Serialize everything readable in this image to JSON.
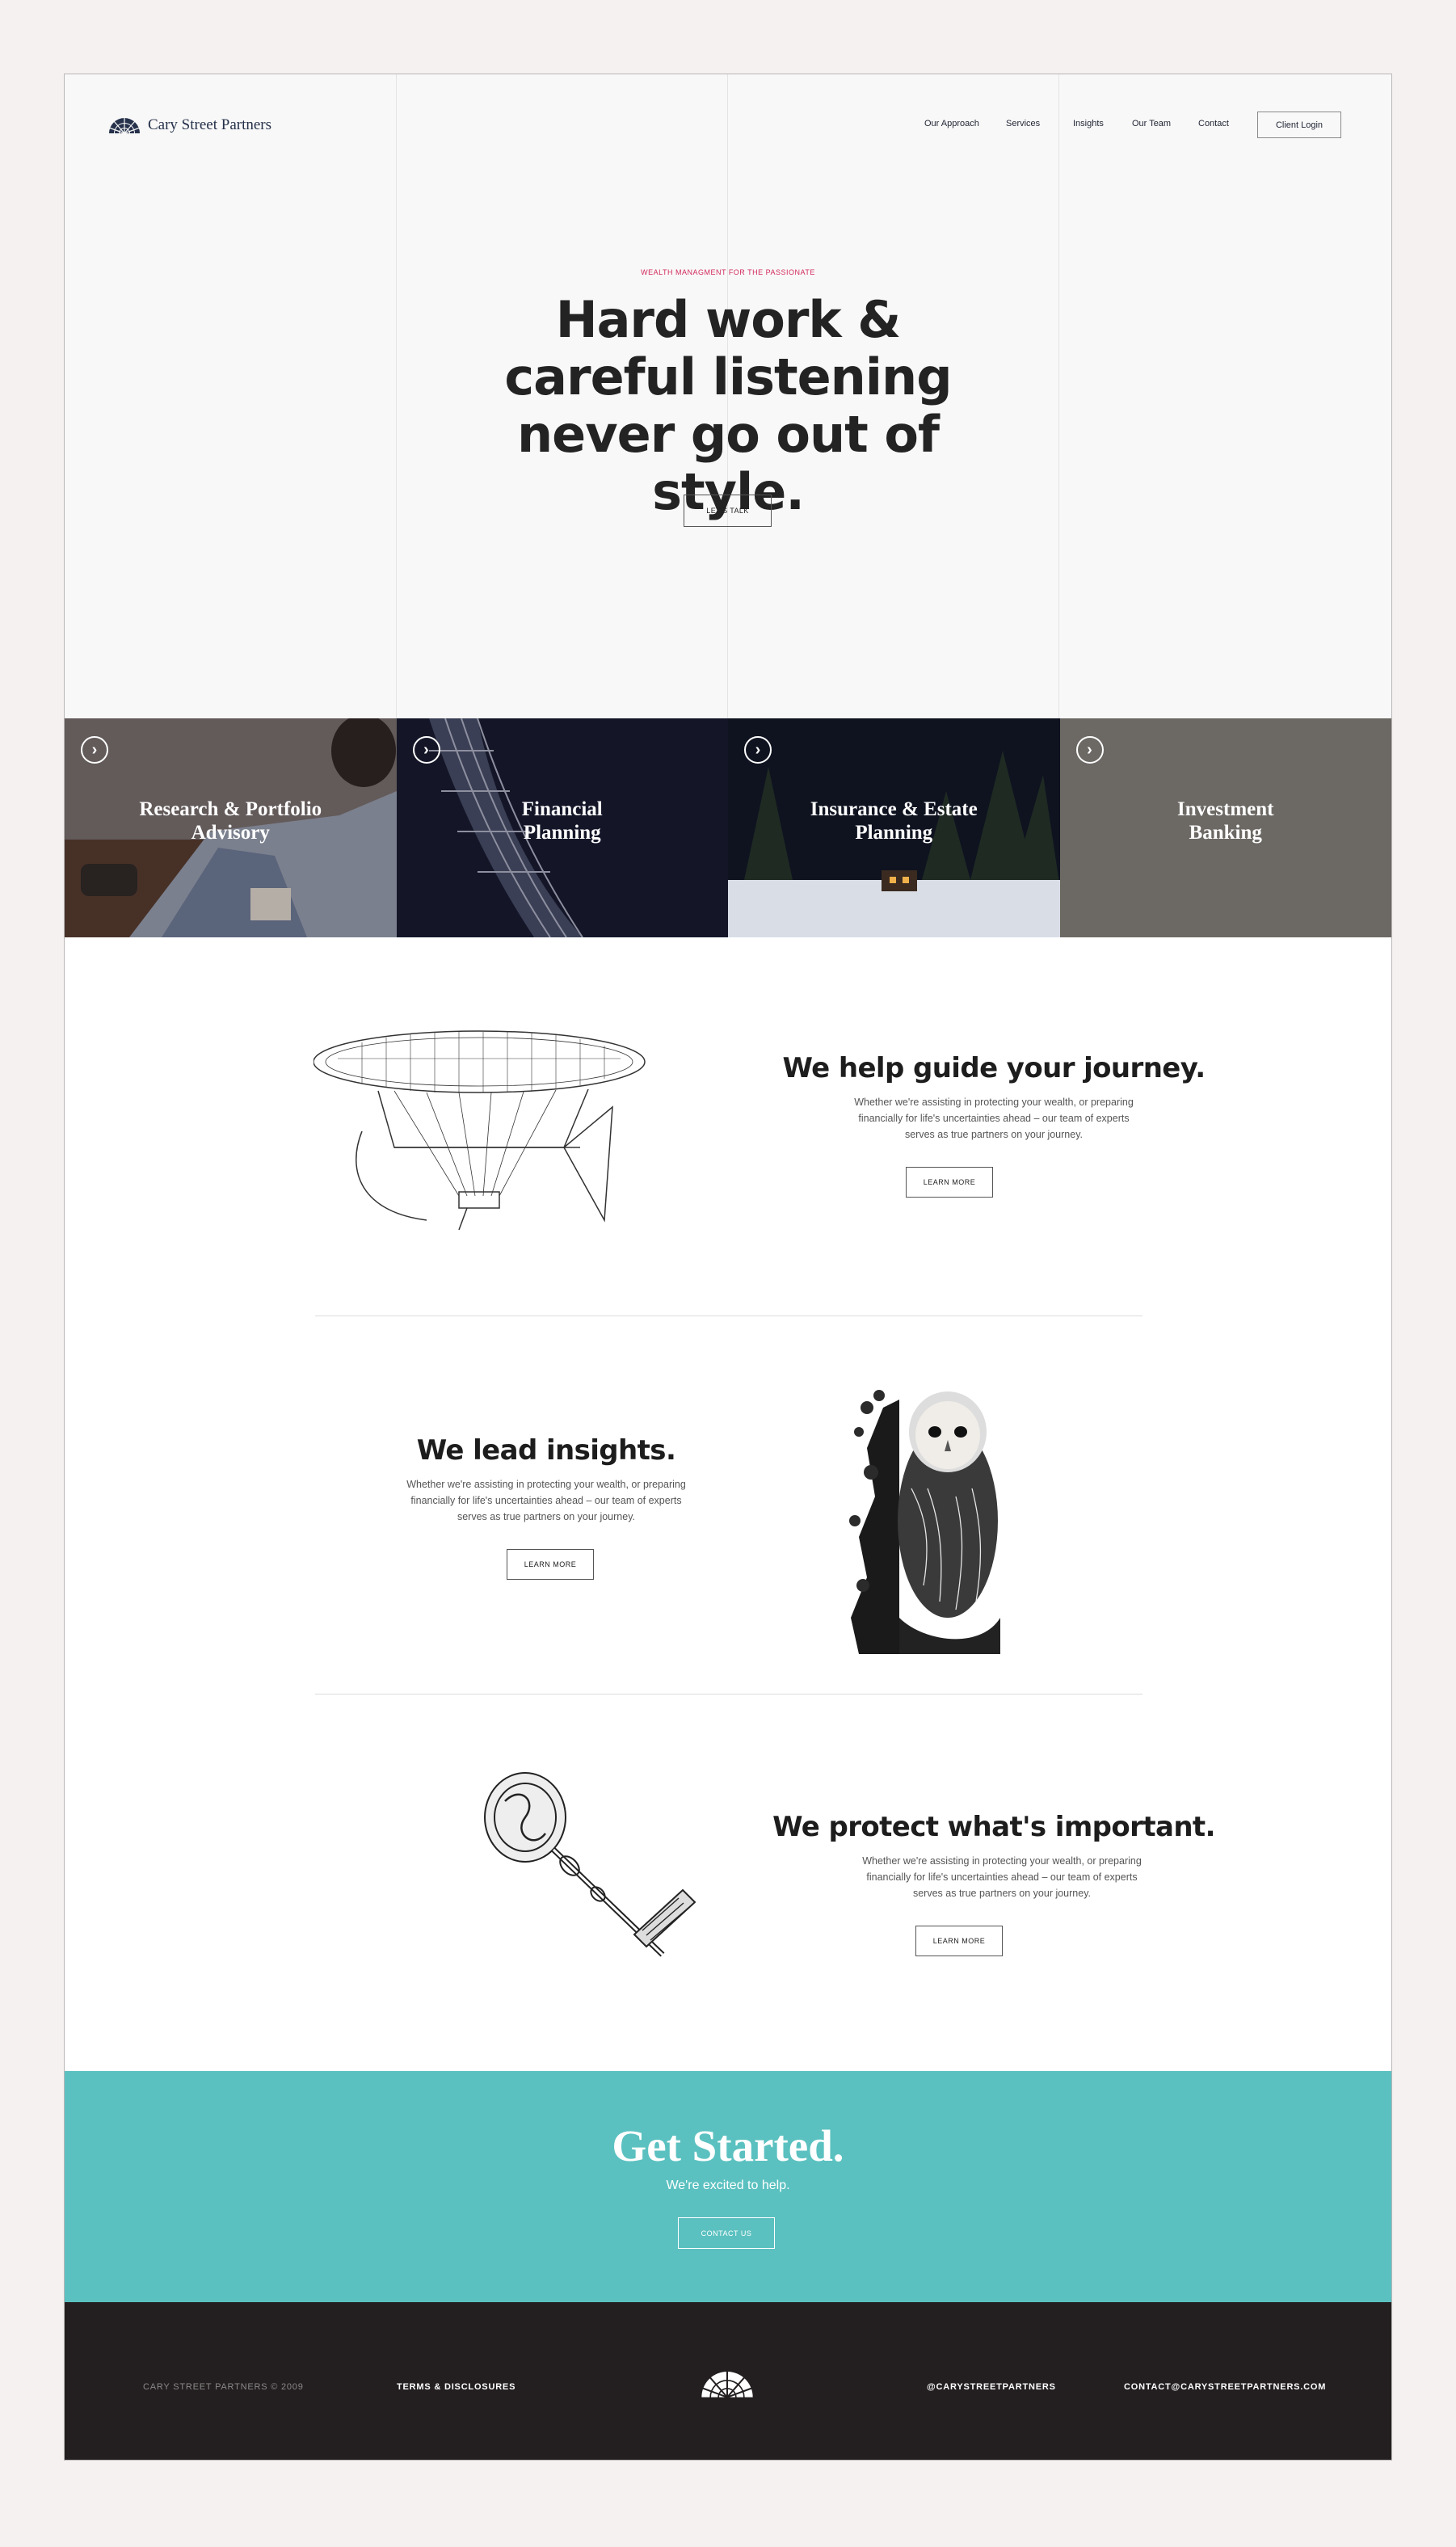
{
  "header": {
    "logo_text": "Cary Street Partners",
    "nav": [
      "Our Approach",
      "Services",
      "Insights",
      "Our Team",
      "Contact"
    ],
    "login_label": "Client Login"
  },
  "hero": {
    "eyebrow": "WEALTH MANAGMENT FOR THE PASSIONATE",
    "headline": "Hard work & careful listening never go out of style.",
    "cta_label": "LET'S TALK"
  },
  "tiles": [
    {
      "title": "Research & Portfolio Advisory"
    },
    {
      "title": "Financial Planning"
    },
    {
      "title": "Insurance & Estate Planning"
    },
    {
      "title": "Investment Banking"
    }
  ],
  "features": [
    {
      "title": "We help guide your journey.",
      "body": "Whether we're assisting in protecting your wealth, or preparing financially for life's uncertainties ahead – our team of experts serves as true partners on your journey.",
      "button": "LEARN MORE"
    },
    {
      "title": "We lead insights.",
      "body": "Whether we're assisting in protecting your wealth, or preparing financially for life's uncertainties ahead – our team of experts serves as true partners on your journey.",
      "button": "LEARN MORE"
    },
    {
      "title": "We protect what's important.",
      "body": "Whether we're assisting in protecting your wealth, or preparing financially for life's uncertainties ahead – our team of experts serves as true partners on your journey.",
      "button": "LEARN MORE"
    }
  ],
  "cta": {
    "title": "Get Started.",
    "subtitle": "We're excited to help.",
    "button": "CONTACT US"
  },
  "footer": {
    "copyright": "CARY STREET PARTNERS © 2009",
    "terms": "TERMS & DISCLOSURES",
    "social": "@CARYSTREETPARTNERS",
    "email": "CONTACT@CARYSTREETPARTNERS.COM"
  },
  "colors": {
    "accent_pink": "#d22a5d",
    "cta_teal": "#5bc1c0",
    "footer_dark": "#231f20",
    "brand_navy": "#25304a"
  },
  "icons": [
    "logo-fan-icon",
    "arrow-right-circle-icon",
    "airship-illustration",
    "owl-illustration",
    "key-illustration"
  ]
}
